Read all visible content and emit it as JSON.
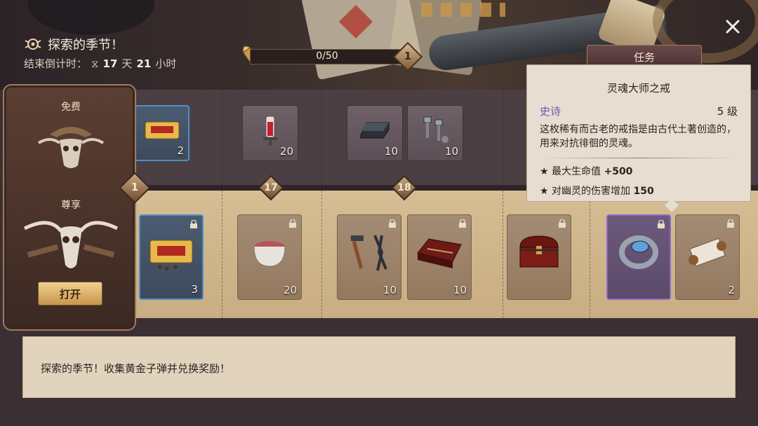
{
  "header": {
    "season_title": "探索的季节！",
    "countdown_label": "结束倒计时：",
    "countdown_days": "17",
    "countdown_days_unit": "天",
    "countdown_hours": "21",
    "countdown_hours_unit": "小时",
    "progress_text": "0/50",
    "current_level": "1",
    "task_tab": "任务"
  },
  "left_panel": {
    "free_label": "免费",
    "premium_label": "尊享",
    "level": "1",
    "open_button": "打开"
  },
  "tiers": {
    "t17": "17",
    "t18": "18"
  },
  "free_rewards": [
    {
      "icon": "coffee-icon",
      "count": "2"
    },
    {
      "icon": "syringe-icon",
      "count": "20"
    },
    {
      "icon": "metal-ingot-icon",
      "count": "10"
    },
    {
      "icon": "bolts-icon",
      "count": "10"
    }
  ],
  "premium_rewards": [
    {
      "icon": "coffee-icon",
      "count": "3"
    },
    {
      "icon": "bowl-icon",
      "count": "20"
    },
    {
      "icon": "tools-icon",
      "count": "10"
    },
    {
      "icon": "toolbox-icon",
      "count": "10"
    },
    {
      "icon": "chest-icon",
      "count": ""
    },
    {
      "icon": "ring-icon",
      "count": ""
    },
    {
      "icon": "scroll-icon",
      "count": "2"
    }
  ],
  "tooltip": {
    "name": "灵魂大师之戒",
    "rarity": "史诗",
    "level": "5 级",
    "description": "这枚稀有而古老的戒指是由古代土著创造的，用来对抗徘徊的灵魂。",
    "stat1_label": "★ 最大生命值",
    "stat1_value": "+500",
    "stat2_label": "★ 对幽灵的伤害增加",
    "stat2_value": "150"
  },
  "message": "探索的季节！收集黄金子弹并兑换奖励！",
  "colors": {
    "epic": "#7a52b6",
    "rare_border": "#4f8ec8",
    "epic_border": "#8a6ac8"
  }
}
